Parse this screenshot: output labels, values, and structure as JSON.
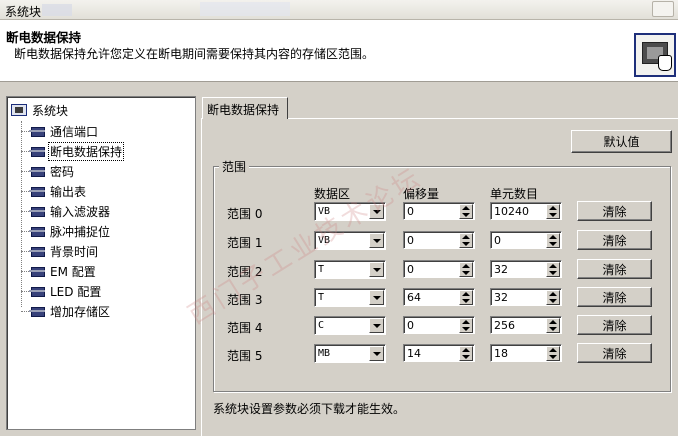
{
  "window": {
    "title": "系统块"
  },
  "header": {
    "title": "断电数据保持",
    "description": "断电数据保持允许您定义在断电期间需要保持其内容的存储区范围。"
  },
  "tree": {
    "root": "系统块",
    "items": [
      {
        "label": "通信端口",
        "selected": false
      },
      {
        "label": "断电数据保持",
        "selected": true
      },
      {
        "label": "密码",
        "selected": false
      },
      {
        "label": "输出表",
        "selected": false
      },
      {
        "label": "输入滤波器",
        "selected": false
      },
      {
        "label": "脉冲捕捉位",
        "selected": false
      },
      {
        "label": "背景时间",
        "selected": false
      },
      {
        "label": "EM 配置",
        "selected": false
      },
      {
        "label": "LED 配置",
        "selected": false
      },
      {
        "label": "增加存储区",
        "selected": false
      }
    ]
  },
  "tab": {
    "label": "断电数据保持"
  },
  "buttons": {
    "default": "默认值"
  },
  "range": {
    "group_label": "范围",
    "columns": {
      "area": "数据区",
      "offset": "偏移量",
      "count": "单元数目"
    },
    "rows": [
      {
        "label": "范围 0",
        "area": "VB",
        "offset": "0",
        "count": "10240",
        "clear": "清除"
      },
      {
        "label": "范围 1",
        "area": "VB",
        "offset": "0",
        "count": "0",
        "clear": "清除"
      },
      {
        "label": "范围 2",
        "area": "T",
        "offset": "0",
        "count": "32",
        "clear": "清除"
      },
      {
        "label": "范围 3",
        "area": "T",
        "offset": "64",
        "count": "32",
        "clear": "清除"
      },
      {
        "label": "范围 4",
        "area": "C",
        "offset": "0",
        "count": "256",
        "clear": "清除"
      },
      {
        "label": "范围 5",
        "area": "MB",
        "offset": "14",
        "count": "18",
        "clear": "清除"
      }
    ]
  },
  "footer_note": "系统块设置参数必须下载才能生效。",
  "watermark": "西门子工业技术论坛"
}
